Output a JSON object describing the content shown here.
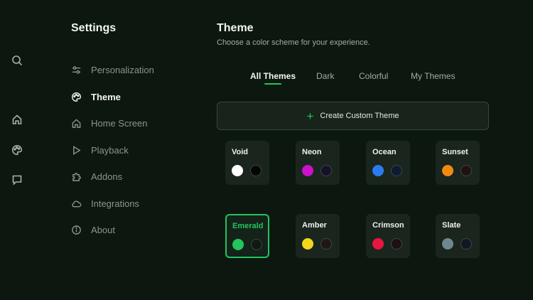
{
  "rail": {
    "icons": [
      "search-icon",
      "home-icon",
      "palette-icon",
      "chat-icon"
    ]
  },
  "settings": {
    "title": "Settings",
    "menu": [
      {
        "label": "Personalization",
        "icon": "sliders-icon",
        "active": false
      },
      {
        "label": "Theme",
        "icon": "palette-icon",
        "active": true
      },
      {
        "label": "Home Screen",
        "icon": "home-icon",
        "active": false
      },
      {
        "label": "Playback",
        "icon": "play-icon",
        "active": false
      },
      {
        "label": "Addons",
        "icon": "puzzle-icon",
        "active": false
      },
      {
        "label": "Integrations",
        "icon": "cloud-icon",
        "active": false
      },
      {
        "label": "About",
        "icon": "info-icon",
        "active": false
      }
    ]
  },
  "theme": {
    "title": "Theme",
    "subtitle": "Choose a color scheme for your experience.",
    "tabs": [
      {
        "label": "All Themes",
        "active": true
      },
      {
        "label": "Dark",
        "active": false
      },
      {
        "label": "Colorful",
        "active": false
      },
      {
        "label": "My Themes",
        "active": false
      }
    ],
    "create_label": "Create Custom Theme",
    "themes": [
      {
        "name": "Void",
        "accent": "#ffffff",
        "background": "#050505",
        "selected": false
      },
      {
        "name": "Neon",
        "accent": "#cc11cc",
        "background": "#16112a",
        "selected": false
      },
      {
        "name": "Ocean",
        "accent": "#2a7bf0",
        "background": "#0c1a33",
        "selected": false
      },
      {
        "name": "Sunset",
        "accent": "#f28a10",
        "background": "#1f1212",
        "selected": false
      },
      {
        "name": "Emerald",
        "accent": "#22c55e",
        "background": "#0e1a12",
        "selected": true
      },
      {
        "name": "Amber",
        "accent": "#f2d71a",
        "background": "#1e1712",
        "selected": false
      },
      {
        "name": "Crimson",
        "accent": "#e8163e",
        "background": "#1f0e14",
        "selected": false
      },
      {
        "name": "Slate",
        "accent": "#6f8790",
        "background": "#131624",
        "selected": false
      }
    ]
  },
  "colors": {
    "accent": "#22c55e",
    "page_background": "#0c170f"
  }
}
